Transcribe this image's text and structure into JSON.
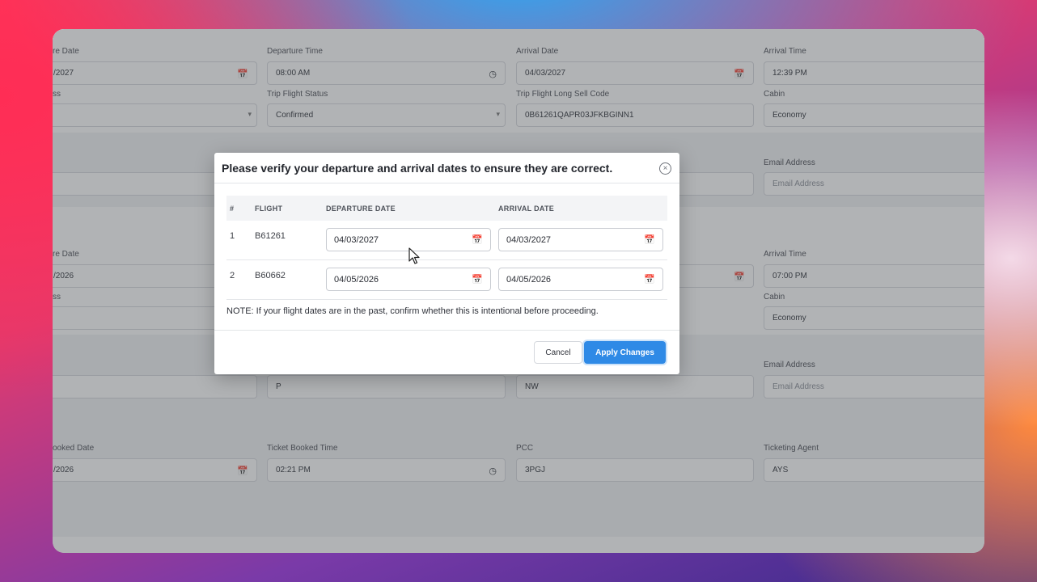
{
  "background_form": {
    "section1": {
      "row1": [
        {
          "label": "re Date",
          "value": "/2027",
          "icon": "calendar-icon"
        },
        {
          "label": "Departure Time",
          "value": "08:00 AM",
          "icon": "clock-icon"
        },
        {
          "label": "Arrival Date",
          "value": "04/03/2027",
          "icon": "calendar-icon"
        },
        {
          "label": "Arrival Time",
          "value": "12:39 PM"
        }
      ],
      "row2": [
        {
          "label": "ss",
          "value": ""
        },
        {
          "label": "Trip Flight Status",
          "value": "Confirmed"
        },
        {
          "label": "Trip Flight Long Sell Code",
          "value": "0B61261QAPR03JFKBGINN1"
        },
        {
          "label": "Cabin",
          "value": "Economy"
        }
      ],
      "email_label": "Email Address",
      "email_placeholder": "Email Address"
    },
    "section2": {
      "row1": [
        {
          "label": "re Date",
          "value": "/2026"
        },
        {
          "label": "Arrival Time",
          "value": "07:00 PM"
        }
      ],
      "row2": [
        {
          "label": "ss",
          "value": ""
        },
        {
          "label": "Cabin",
          "value": "Economy"
        }
      ],
      "row3": [
        {
          "value": ""
        },
        {
          "value": "P"
        },
        {
          "value": "NW"
        }
      ],
      "email_label": "Email Address",
      "email_placeholder": "Email Address"
    },
    "section3": {
      "row1": [
        {
          "label": "ooked Date",
          "value": "/2026"
        },
        {
          "label": "Ticket Booked Time",
          "value": "02:21 PM"
        },
        {
          "label": "PCC",
          "value": "3PGJ"
        },
        {
          "label": "Ticketing Agent",
          "value": "AYS"
        }
      ]
    }
  },
  "modal": {
    "title": "Please verify your departure and arrival dates to ensure they are correct.",
    "close_glyph": "×",
    "columns": [
      "#",
      "FLIGHT",
      "DEPARTURE DATE",
      "ARRIVAL DATE"
    ],
    "rows": [
      {
        "num": "1",
        "flight": "B61261",
        "departure": "04/03/2027",
        "arrival": "04/03/2027"
      },
      {
        "num": "2",
        "flight": "B60662",
        "departure": "04/05/2026",
        "arrival": "04/05/2026"
      }
    ],
    "note": "NOTE: If your flight dates are in the past, confirm whether this is intentional before proceeding.",
    "cancel_label": "Cancel",
    "apply_label": "Apply Changes"
  },
  "colors": {
    "accent": "#2f8ae6",
    "overlay": "#464a4e"
  }
}
